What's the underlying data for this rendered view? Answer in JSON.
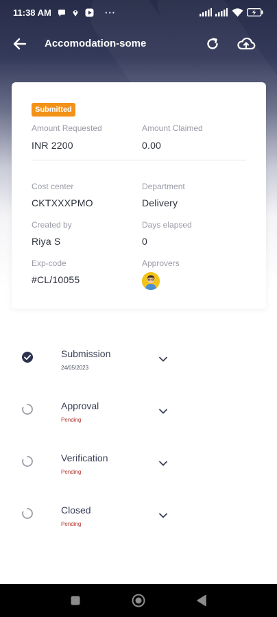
{
  "status_bar": {
    "time": "11:38 AM",
    "more": "···",
    "icons_left": [
      "chat-bubble-icon",
      "location-pin-icon",
      "play-icon"
    ],
    "icons_right": [
      "signal-icon",
      "signal-icon",
      "wifi-icon",
      "battery-charging-icon"
    ]
  },
  "app_bar": {
    "title": "Accomodation-some",
    "icons": [
      "back-arrow-icon",
      "refresh-icon",
      "cloud-upload-icon"
    ]
  },
  "card": {
    "status_badge": "Submitted",
    "fields": {
      "amount_requested": {
        "label": "Amount Requested",
        "value": "INR 2200"
      },
      "amount_claimed": {
        "label": "Amount Claimed",
        "value": "0.00"
      },
      "cost_center": {
        "label": "Cost center",
        "value": "CKTXXXPMO"
      },
      "department": {
        "label": "Department",
        "value": "Delivery"
      },
      "created_by": {
        "label": "Created by",
        "value": "Riya S"
      },
      "days_elapsed": {
        "label": "Days elapsed",
        "value": "0"
      },
      "exp_code": {
        "label": "Exp-code",
        "value": "#CL/10055"
      },
      "approvers": {
        "label": "Approvers"
      }
    }
  },
  "timeline": [
    {
      "title": "Submission",
      "sub": "24/05/2023",
      "state": "done"
    },
    {
      "title": "Approval",
      "sub": "Pending",
      "state": "pending"
    },
    {
      "title": "Verification",
      "sub": "Pending",
      "state": "pending"
    },
    {
      "title": "Closed",
      "sub": "Pending",
      "state": "pending"
    }
  ],
  "colors": {
    "header_dark": "#272c48",
    "badge": "#f39218",
    "pending": "#b3342b",
    "done_icon": "#2c3350"
  },
  "nav_bar": {
    "icons": [
      "square-recents-icon",
      "circle-home-icon",
      "triangle-back-icon"
    ]
  }
}
